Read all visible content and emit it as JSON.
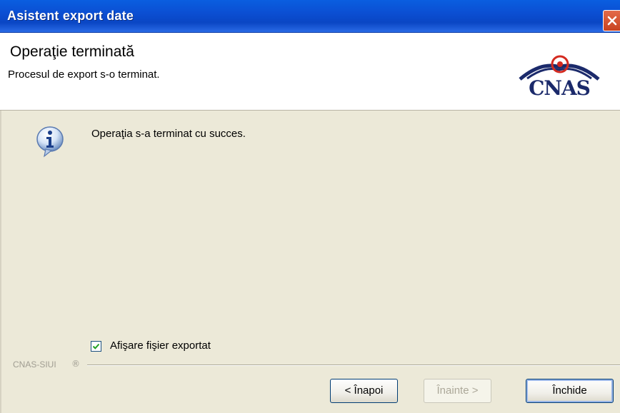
{
  "window": {
    "title": "Asistent export date"
  },
  "header": {
    "title": "Operaţie terminată",
    "subtitle": "Procesul de export s-o terminat.",
    "logo_text": "CNAS"
  },
  "content": {
    "message": "Operaţia s-a terminat cu succes.",
    "checkbox": {
      "label": "Afişare fişier exportat",
      "checked": true
    }
  },
  "footer": {
    "brand": "CNAS-SIUI",
    "brand_symbol": "®",
    "buttons": {
      "back": "< Înapoi",
      "next": "Înainte >",
      "close": "Închide"
    }
  },
  "colors": {
    "title_bar": "#0b4fd3",
    "dialog_bg": "#ece9d8",
    "logo_blue": "#1b2a6b",
    "logo_red": "#d42a20"
  },
  "icons": {
    "info": "info-icon",
    "close": "close-icon",
    "check": "check-icon"
  }
}
